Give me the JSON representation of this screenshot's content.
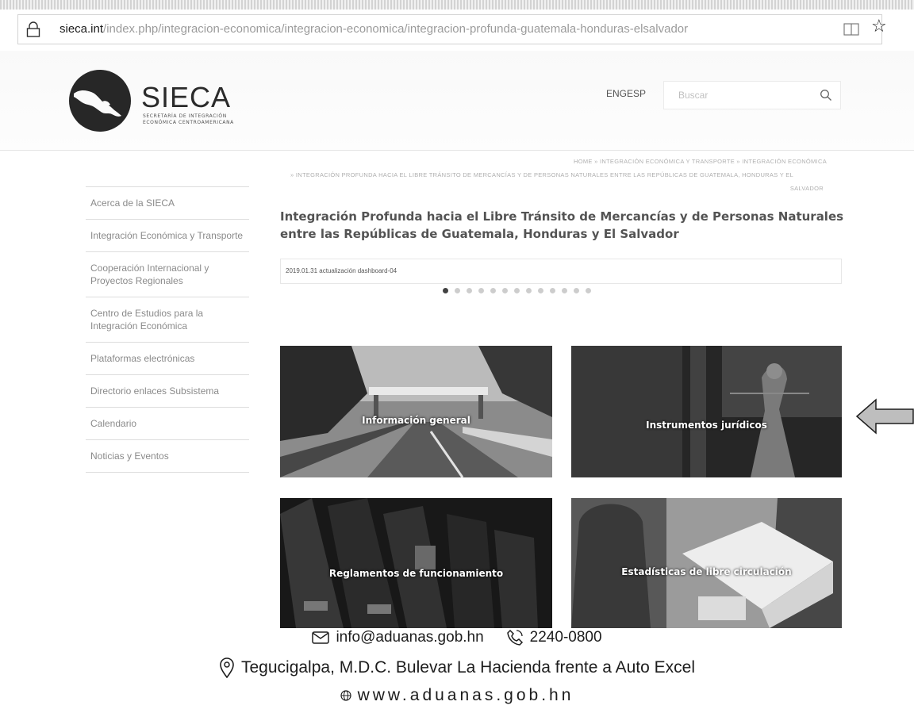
{
  "browser": {
    "url_domain": "sieca.int",
    "url_path": "/index.php/integracion-economica/integracion-economica/integracion-profunda-guatemala-honduras-elsalvador"
  },
  "header": {
    "logo_name": "SIECA",
    "logo_sub_1": "SECRETARÍA DE INTEGRACIÓN",
    "logo_sub_2": "ECONÓMICA CENTROAMERICANA",
    "lang_eng": "ENG",
    "lang_esp": "ESP",
    "search_placeholder": "Buscar"
  },
  "breadcrumb": {
    "line1": "HOME  »  INTEGRACIÓN ECONÓMICA Y TRANSPORTE  »  INTEGRACIÓN ECONÓMICA",
    "line2": "»  INTEGRACIÓN PROFUNDA HACIA EL LIBRE TRÁNSITO DE MERCANCÍAS Y DE PERSONAS NATURALES ENTRE LAS REPÚBLICAS DE GUATEMALA, HONDURAS Y EL",
    "line3": "SALVADOR"
  },
  "sidebar": {
    "items": [
      {
        "label": "Acerca de la SIECA"
      },
      {
        "label": "Integración Económica y Transporte"
      },
      {
        "label": "Cooperación Internacional y Proyectos Regionales"
      },
      {
        "label": "Centro de Estudios para la Integración Económica"
      },
      {
        "label": "Plataformas electrónicas"
      },
      {
        "label": "Directorio enlaces Subsistema"
      },
      {
        "label": "Calendario"
      },
      {
        "label": "Noticias y Eventos"
      }
    ]
  },
  "main": {
    "title": "Integración Profunda hacia el Libre Tránsito de Mercancías y de Personas Naturales entre las Repúblicas de Guatemala, Honduras y El Salvador",
    "slider_caption": "2019.01.31 actualización dashboard-04",
    "slider_dots": 13,
    "slider_active": 0,
    "tiles": [
      {
        "label": "Información general"
      },
      {
        "label": "Instrumentos jurídicos"
      },
      {
        "label": "Reglamentos de funcionamiento"
      },
      {
        "label": "Estadísticas de libre circulación"
      }
    ]
  },
  "footer": {
    "email": "info@aduanas.gob.hn",
    "phone": "2240-0800",
    "address": "Tegucigalpa, M.D.C. Bulevar La Hacienda frente a Auto Excel",
    "website": "www.aduanas.gob.hn"
  }
}
